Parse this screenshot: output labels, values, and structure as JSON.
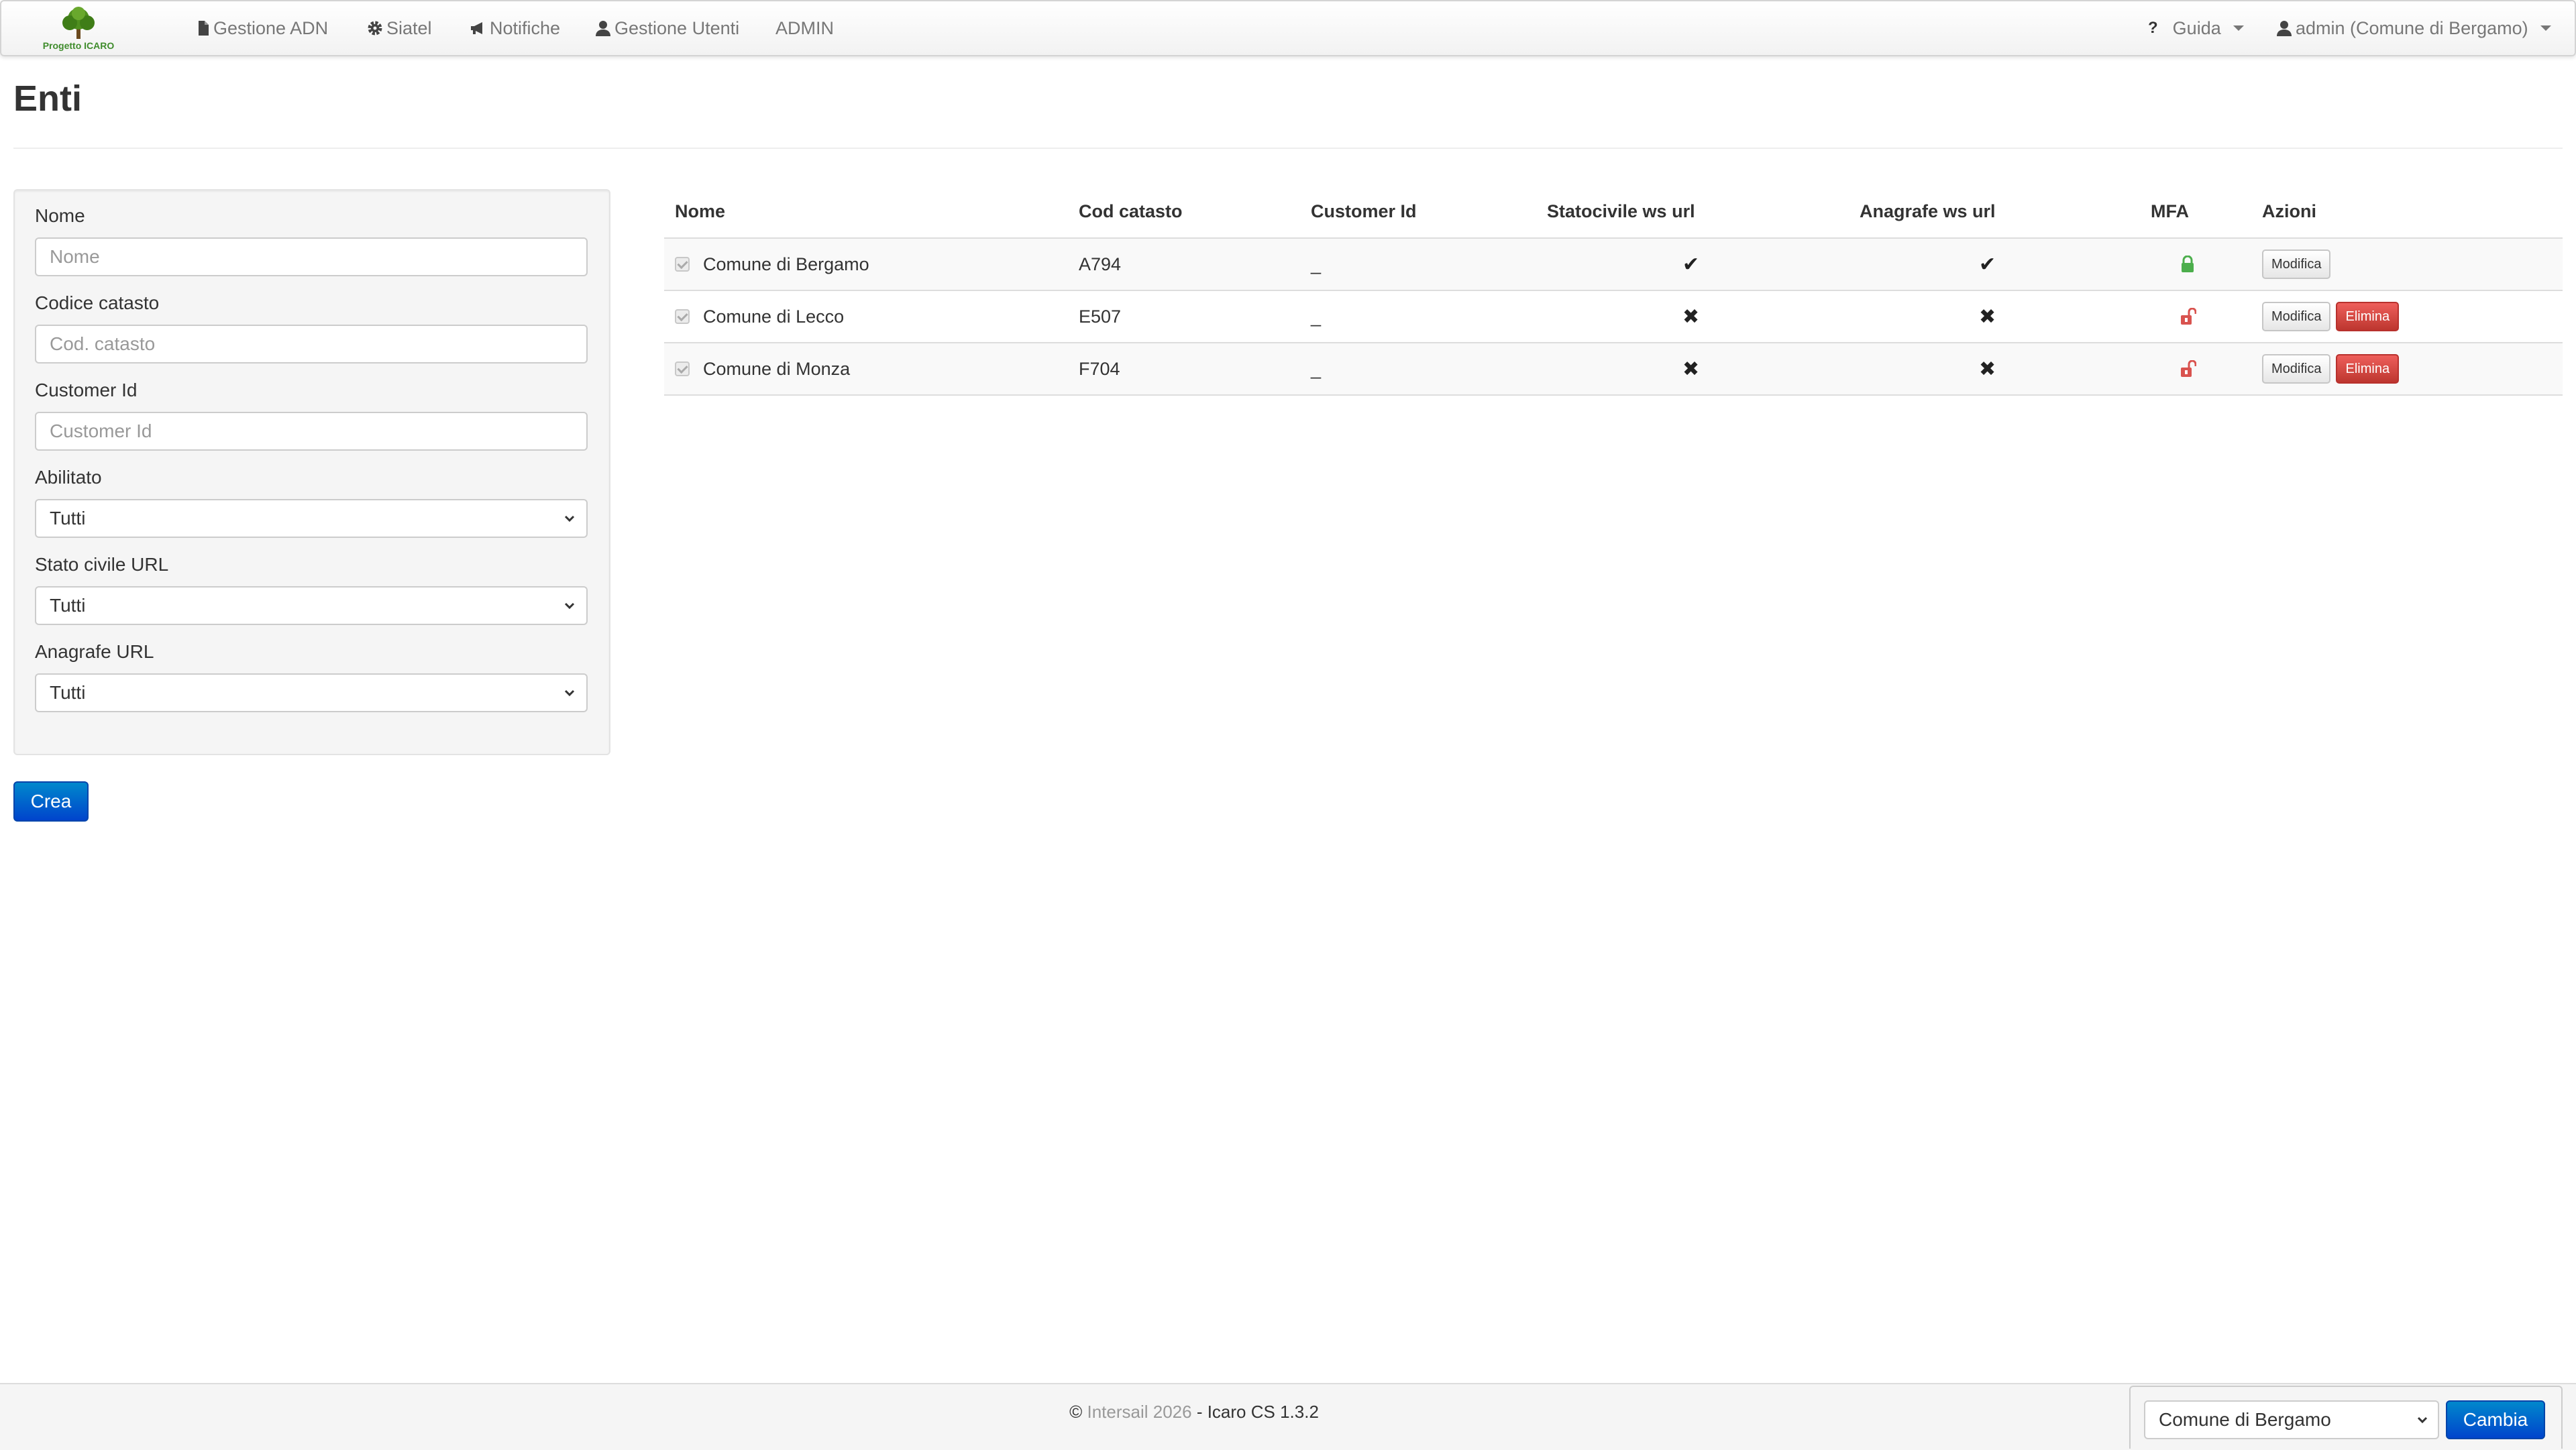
{
  "navbar": {
    "logo_text": "Progetto ICARO",
    "items": [
      {
        "label": "Gestione ADN",
        "icon": "document-icon"
      },
      {
        "label": "Siatel",
        "icon": "gear-icon"
      },
      {
        "label": "Notifiche",
        "icon": "megaphone-icon"
      },
      {
        "label": "Gestione Utenti",
        "icon": "user-icon"
      },
      {
        "label": "ADMIN"
      }
    ],
    "help": {
      "icon_glyph": "?",
      "label": "Guida"
    },
    "user": {
      "label": "admin (Comune di Bergamo)",
      "icon": "user-icon"
    }
  },
  "page": {
    "title": "Enti"
  },
  "filters": {
    "nome": {
      "label": "Nome",
      "placeholder": "Nome",
      "value": ""
    },
    "codice_catasto": {
      "label": "Codice catasto",
      "placeholder": "Cod. catasto",
      "value": ""
    },
    "customer_id": {
      "label": "Customer Id",
      "placeholder": "Customer Id",
      "value": ""
    },
    "abilitato": {
      "label": "Abilitato",
      "value": "Tutti"
    },
    "stato_civile_url": {
      "label": "Stato civile URL",
      "value": "Tutti"
    },
    "anagrafe_url": {
      "label": "Anagrafe URL",
      "value": "Tutti"
    },
    "create_label": "Crea"
  },
  "table": {
    "headers": [
      "Nome",
      "Cod catasto",
      "Customer Id",
      "Statocivile ws url",
      "Anagrafe ws url",
      "MFA",
      "Azioni"
    ],
    "rows": [
      {
        "nome": "Comune di Bergamo",
        "cod_catasto": "A794",
        "customer_id": "_",
        "statocivile": "✔",
        "anagrafe": "✔",
        "mfa": "locked",
        "modifica": "Modifica",
        "elimina": ""
      },
      {
        "nome": "Comune di Lecco",
        "cod_catasto": "E507",
        "customer_id": "_",
        "statocivile": "✖",
        "anagrafe": "✖",
        "mfa": "unlocked",
        "modifica": "Modifica",
        "elimina": "Elimina"
      },
      {
        "nome": "Comune di Monza",
        "cod_catasto": "F704",
        "customer_id": "_",
        "statocivile": "✖",
        "anagrafe": "✖",
        "mfa": "unlocked",
        "modifica": "Modifica",
        "elimina": "Elimina"
      }
    ]
  },
  "footer": {
    "copyright": "©",
    "company": "Intersail 2026",
    "separator": " - ",
    "product": "Icaro CS 1.3.2"
  },
  "ente_switcher": {
    "selected": "Comune di Bergamo",
    "button_label": "Cambia"
  },
  "colors": {
    "primary": "#0055cc",
    "danger": "#d9534f",
    "success": "#5cb85c",
    "lock_open": "#d9534f",
    "lock_closed": "#4cae4c"
  }
}
